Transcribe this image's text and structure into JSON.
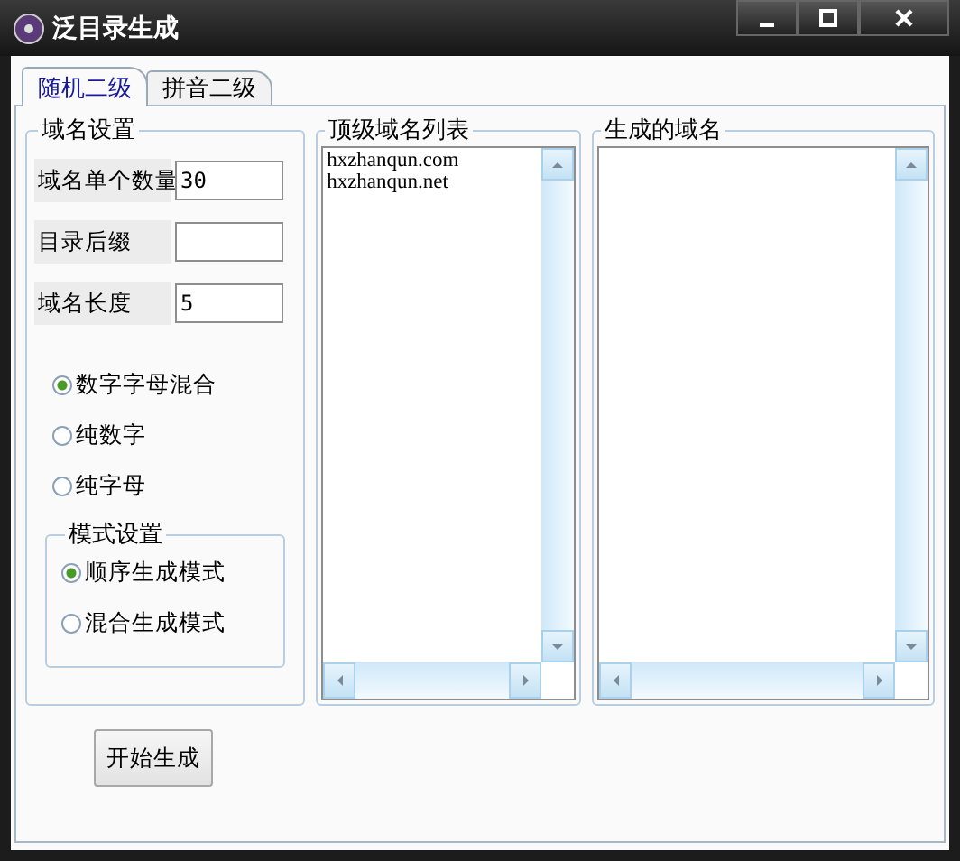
{
  "window": {
    "title": "泛目录生成"
  },
  "tabs": [
    {
      "label": "随机二级",
      "selected": true
    },
    {
      "label": "拼音二级",
      "selected": false
    }
  ],
  "domain_settings": {
    "title": "域名设置",
    "fields": [
      {
        "label": "域名单个数量",
        "value": "30"
      },
      {
        "label": "目录后缀"
      },
      {
        "label": "域名长度",
        "value": "5"
      }
    ],
    "radios": [
      {
        "label": "数字字母混合",
        "selected": true
      },
      {
        "label": "纯数字",
        "selected": false
      },
      {
        "label": "纯字母",
        "selected": false
      }
    ],
    "mode_settings": {
      "title": "模式设置",
      "radios": [
        {
          "label": "顺序生成模式",
          "selected": true
        },
        {
          "label": "混合生成模式",
          "selected": false
        }
      ]
    }
  },
  "tld_list": {
    "title": "顶级域名列表",
    "items": [
      "hxzhanqun.com",
      "hxzhanqun.net"
    ]
  },
  "generated_list": {
    "title": "生成的域名"
  },
  "start_button": "开始生成"
}
